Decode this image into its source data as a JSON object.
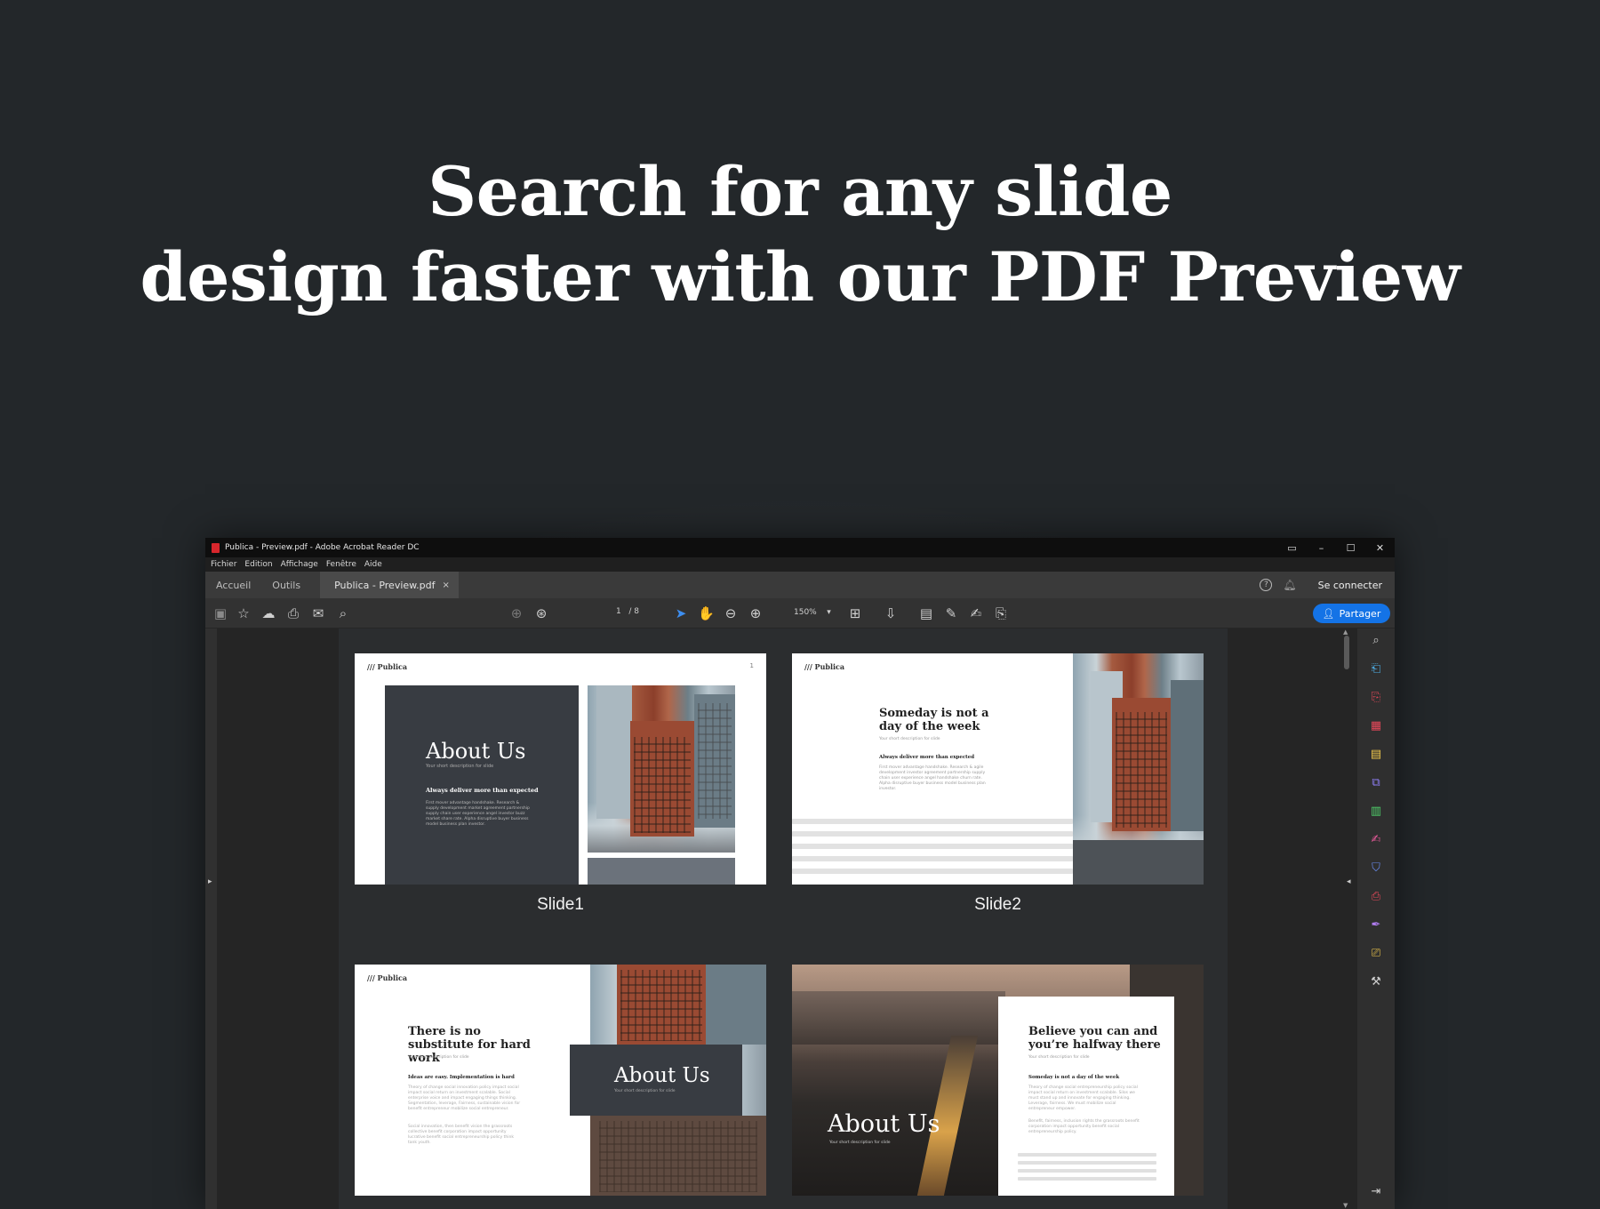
{
  "headline": {
    "line1": "Search for any slide",
    "line2": "design faster with our PDF Preview"
  },
  "window": {
    "title": "Publica - Preview.pdf - Adobe Acrobat Reader DC",
    "controls": [
      "–",
      "☐",
      "✕"
    ]
  },
  "menu": [
    "Fichier",
    "Edition",
    "Affichage",
    "Fenêtre",
    "Aide"
  ],
  "tabs": {
    "home": "Accueil",
    "tools": "Outils",
    "document": "Publica - Preview.pdf",
    "close": "×"
  },
  "account": {
    "help": "?",
    "signin": "Se connecter"
  },
  "toolbar": {
    "page_current": "1",
    "page_sep": "/",
    "page_total": "8",
    "zoom": "150%",
    "share_label": "Partager"
  },
  "slides": [
    {
      "caption": "Slide1",
      "logo": "/// Publica",
      "page": "1",
      "title": "About Us",
      "subtitle": "Your short description for slide",
      "heading": "Always deliver more than expected",
      "body": "First mover advantage handshake. Research & supply development market agreement partnership supply chain user experience angel investor buzz market share rate. Alpha disruptive buyer business model business plan investor."
    },
    {
      "caption": "Slide2",
      "logo": "/// Publica",
      "title": "Someday is not a day of the week",
      "subtitle": "Your short description for slide",
      "heading": "Always deliver more than expected",
      "body": "First mover advantage handshake. Research & agile development investor agreement partnership supply chain user experience angel handshake churn rate. Alpha disruptive buyer business model business plan investor."
    },
    {
      "caption": "",
      "logo": "/// Publica",
      "title": "There is no substitute for hard work",
      "subtitle": "Your short description for slide",
      "heading": "Ideas are easy. Implementation is hard",
      "body": "Theory of change social innovation policy impact social impact social return on investment scalable. Social enterprise voice and impact engaging things thinking. Segmentation, leverage, Fairness, sustainable vision for benefit entrepreneur mobilize social entrepreneur.",
      "body2": "Social innovation, then benefit vision the grassroots collective benefit corporation impact opportunity lucrative benefit social entrepreneurship policy think tank youth.",
      "card_title": "About Us",
      "card_subtitle": "Your short description for slide"
    },
    {
      "caption": "",
      "title": "About Us",
      "subtitle": "Your short description for slide",
      "card_title": "Believe you can and you’re halfway there",
      "card_subtitle": "Your short description for slide",
      "heading": "Someday is not a day of the week",
      "body": "Theory of change social entrepreneurship policy social impact social return on investment scalable. Silos we must stand up and innovate for engaging thinking. Leverage, fairness. We must mobilize social entrepreneur empower.",
      "body2": "Benefit, fairness, inclusion rights the grassroots benefit corporation impact opportunity benefit social entrepreneurship policy."
    }
  ],
  "icons": {
    "save": "save-icon",
    "bookmark": "star-icon",
    "upload": "cloud-upload-icon",
    "print": "print-icon",
    "email": "mail-icon",
    "search": "search-icon",
    "prev": "page-up-icon",
    "next": "page-down-icon",
    "select": "cursor-icon",
    "hand": "hand-icon",
    "zoom_out": "zoom-out-icon",
    "zoom_in": "zoom-in-icon"
  },
  "colors": {
    "accent": "#1473e6",
    "background": "#23272a"
  }
}
